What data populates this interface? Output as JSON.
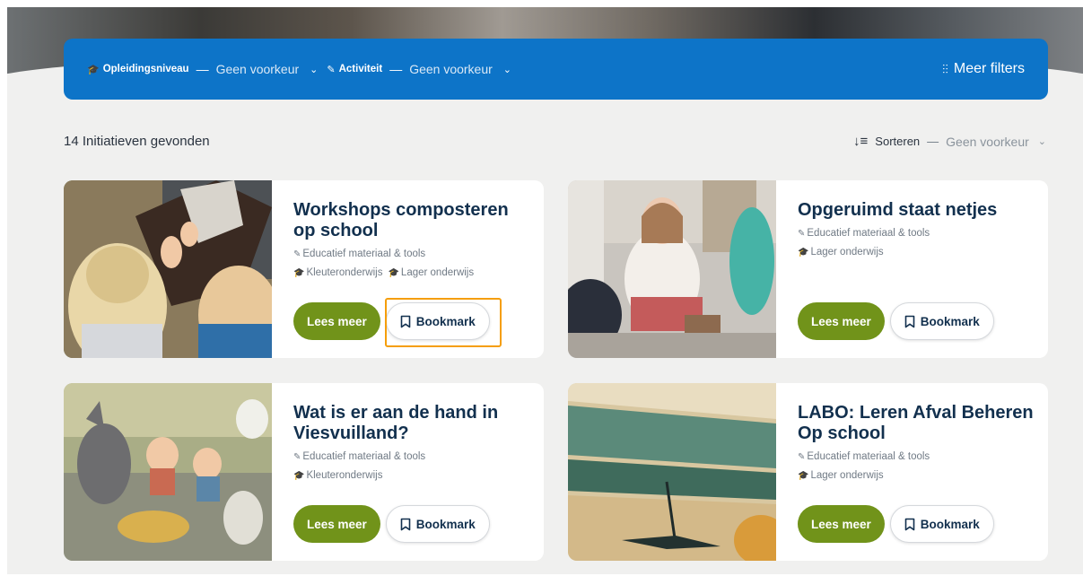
{
  "filters": [
    {
      "icon": "graduation-cap-icon",
      "glyph": "🎓",
      "name": "Opleidingsniveau",
      "dash": "—",
      "value": "Geen voorkeur"
    },
    {
      "icon": "pencil-icon",
      "glyph": "✎",
      "name": "Activiteit",
      "dash": "—",
      "value": "Geen voorkeur"
    }
  ],
  "more_filters": {
    "glyph": "⫶",
    "label": "Meer filters"
  },
  "results_count": "14 Initiatieven gevonden",
  "sort": {
    "label": "Sorteren",
    "dash": "—",
    "value": "Geen voorkeur"
  },
  "cards": [
    {
      "title": "Workshops composteren op school",
      "category": "Educatief materiaal & tools",
      "levels": [
        "Kleuteronderwijs",
        "Lager onderwijs"
      ],
      "read_label": "Lees meer",
      "bookmark_label": "Bookmark"
    },
    {
      "title": "Opgeruimd staat netjes",
      "category": "Educatief materiaal & tools",
      "levels": [
        "Lager onderwijs"
      ],
      "read_label": "Lees meer",
      "bookmark_label": "Bookmark"
    },
    {
      "title": "Wat is er aan de hand in Viesvuilland?",
      "category": "Educatief materiaal & tools",
      "levels": [
        "Kleuteronderwijs"
      ],
      "read_label": "Lees meer",
      "bookmark_label": "Bookmark"
    },
    {
      "title": "LABO: Leren Afval Beheren Op school",
      "category": "Educatief materiaal & tools",
      "levels": [
        "Lager onderwijs"
      ],
      "read_label": "Lees meer",
      "bookmark_label": "Bookmark"
    }
  ],
  "colors": {
    "filter_bar": "#0d74c8",
    "read_button": "#71931a",
    "title": "#12304e",
    "highlight": "#f59e0b"
  }
}
